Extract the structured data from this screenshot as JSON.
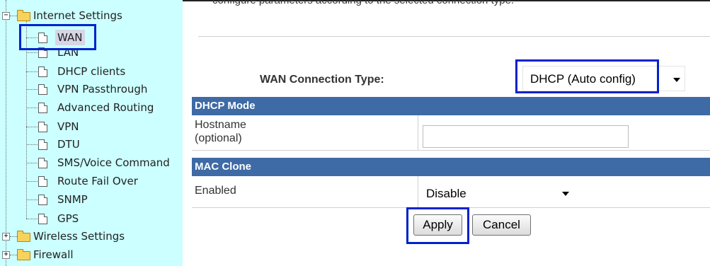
{
  "tree": {
    "internet_settings": "Internet Settings",
    "items": [
      "WAN",
      "LAN",
      "DHCP clients",
      "VPN Passthrough",
      "Advanced Routing",
      "VPN",
      "DTU",
      "SMS/Voice Command",
      "Route Fail Over",
      "SNMP",
      "GPS"
    ],
    "selected": "WAN",
    "wireless_settings": "Wireless Settings",
    "firewall": "Firewall",
    "expander_collapsed": "+",
    "expander_expanded": "−"
  },
  "main": {
    "description": "configure parameters according to the selected connection type.",
    "wan_type_label": "WAN Connection Type:",
    "wan_type_value": "DHCP (Auto config)",
    "dhcp_section": "DHCP Mode",
    "hostname_label_1": "Hostname",
    "hostname_label_2": "(optional)",
    "hostname_value": "",
    "mac_section": "MAC Clone",
    "enabled_label": "Enabled",
    "enabled_value": "Disable",
    "apply_label": "Apply",
    "cancel_label": "Cancel"
  },
  "colors": {
    "tree_background": "#ccffff",
    "section_header": "#3e6aa5",
    "highlight_box": "#0022cc"
  }
}
